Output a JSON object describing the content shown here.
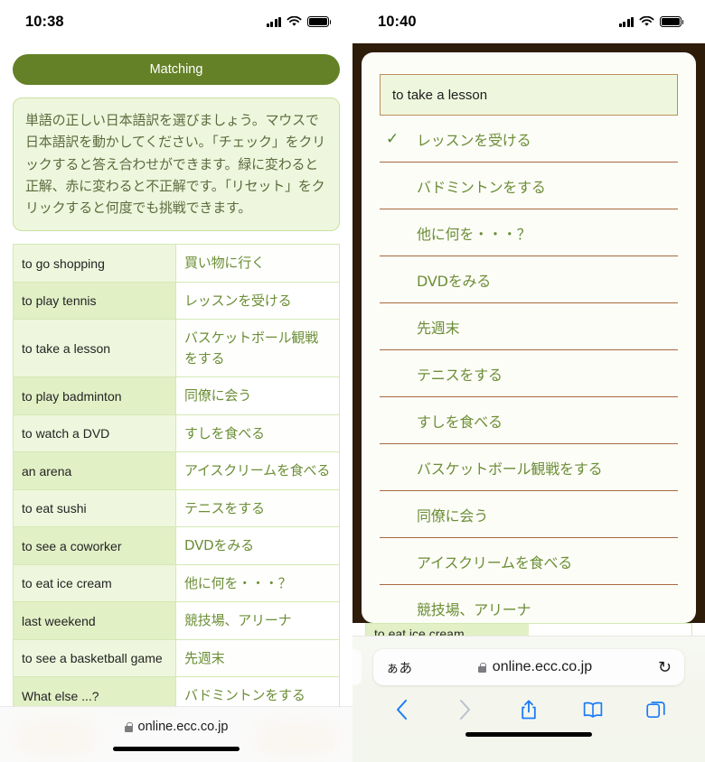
{
  "left": {
    "status": {
      "time": "10:38",
      "signal_icon": "cellular-bars-icon",
      "wifi_icon": "wifi-icon",
      "battery_icon": "battery-icon"
    },
    "title_button": "Matching",
    "instructions": "単語の正しい日本語訳を選びましょう。マウスで日本語訳を動かしてください。「チェック」をクリックすると答え合わせができます。緑に変わると正解、赤に変わると不正解です。「リセット」をクリックすると何度でも挑戦できます。",
    "table": {
      "rows": [
        {
          "en": "to go shopping",
          "jp": "買い物に行く"
        },
        {
          "en": "to play tennis",
          "jp": "レッスンを受ける"
        },
        {
          "en": "to take a lesson",
          "jp": "バスケットボール観戦をする"
        },
        {
          "en": "to play badminton",
          "jp": "同僚に会う"
        },
        {
          "en": "to watch a DVD",
          "jp": "すしを食べる"
        },
        {
          "en": "an arena",
          "jp": "アイスクリームを食べる"
        },
        {
          "en": "to eat sushi",
          "jp": "テニスをする"
        },
        {
          "en": "to see a coworker",
          "jp": "DVDをみる"
        },
        {
          "en": "to eat ice cream",
          "jp": "他に何を・・・？"
        },
        {
          "en": "last weekend",
          "jp": "競技場、アリーナ"
        },
        {
          "en": "to see a basketball game",
          "jp": "先週末"
        },
        {
          "en": "What else ...?",
          "jp": "バドミントンをする"
        }
      ]
    },
    "bottom_bar": {
      "lock_icon": "lock-icon",
      "url": "online.ecc.co.jp"
    }
  },
  "right": {
    "status": {
      "time": "10:40",
      "signal_icon": "cellular-bars-icon",
      "wifi_icon": "wifi-icon",
      "battery_icon": "battery-icon"
    },
    "picker": {
      "header_value": "to take a lesson",
      "check_icon": "check-icon",
      "options": [
        {
          "label": "レッスンを受ける",
          "selected": true
        },
        {
          "label": "バドミントンをする",
          "selected": false
        },
        {
          "label": "他に何を・・・？",
          "selected": false
        },
        {
          "label": "DVDをみる",
          "selected": false
        },
        {
          "label": "先週末",
          "selected": false
        },
        {
          "label": "テニスをする",
          "selected": false
        },
        {
          "label": "すしを食べる",
          "selected": false
        },
        {
          "label": "バスケットボール観戦をする",
          "selected": false
        },
        {
          "label": "同僚に会う",
          "selected": false
        },
        {
          "label": "アイスクリームを食べる",
          "selected": false
        },
        {
          "label": "競技場、アリーナ",
          "selected": false
        }
      ]
    },
    "behind_row": {
      "en": "to eat ice cream"
    },
    "browser": {
      "text_size_label": "ぁあ",
      "lock_icon": "lock-icon",
      "url": "online.ecc.co.jp",
      "reload_icon": "reload-icon",
      "back_icon": "back-chevron-icon",
      "forward_icon": "forward-chevron-icon",
      "share_icon": "share-icon",
      "bookmarks_icon": "book-icon",
      "tabs_icon": "tabs-icon"
    }
  },
  "colors": {
    "accent_green": "#648127",
    "cell_green": "#eef7dd",
    "jp_text": "#6c8e36",
    "orange": "#f0a030",
    "divider_brown": "#a8693f",
    "link_blue": "#1a7cf7"
  }
}
